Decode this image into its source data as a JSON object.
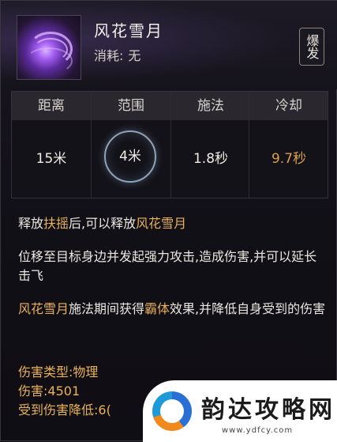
{
  "skill": {
    "name": "风花雪月",
    "cost_label": "消耗:",
    "cost_value": "无",
    "tag": "爆发"
  },
  "stats": [
    {
      "label": "距离",
      "value": "15米"
    },
    {
      "label": "范围",
      "value": "4米"
    },
    {
      "label": "施法",
      "value": "1.8秒"
    },
    {
      "label": "冷却",
      "value": "9.7秒"
    }
  ],
  "description": {
    "line1_a": "释放",
    "line1_b": "扶摇",
    "line1_c": "后,可以释放",
    "line1_d": "风花雪月",
    "para2": "位移至目标身边并发起强力攻击,造成伤害,并可以延长击飞",
    "para3_a": "风花雪月",
    "para3_b": "施法期间获得",
    "para3_c": "霸体",
    "para3_d": "效果,并降低自身受到的伤害"
  },
  "properties": {
    "damage_type_label": "伤害类型:",
    "damage_type_value": "物理",
    "damage_label": "伤害:",
    "damage_value": "4501",
    "reduction_label": "受到伤害降低:",
    "reduction_value": "6("
  },
  "watermark": {
    "brand": "韵达攻略网",
    "url": "www.ydfcy.com"
  },
  "colors": {
    "highlight": "#e8b15a",
    "cooldown": "#d9a04a",
    "text": "#ebe7df"
  }
}
